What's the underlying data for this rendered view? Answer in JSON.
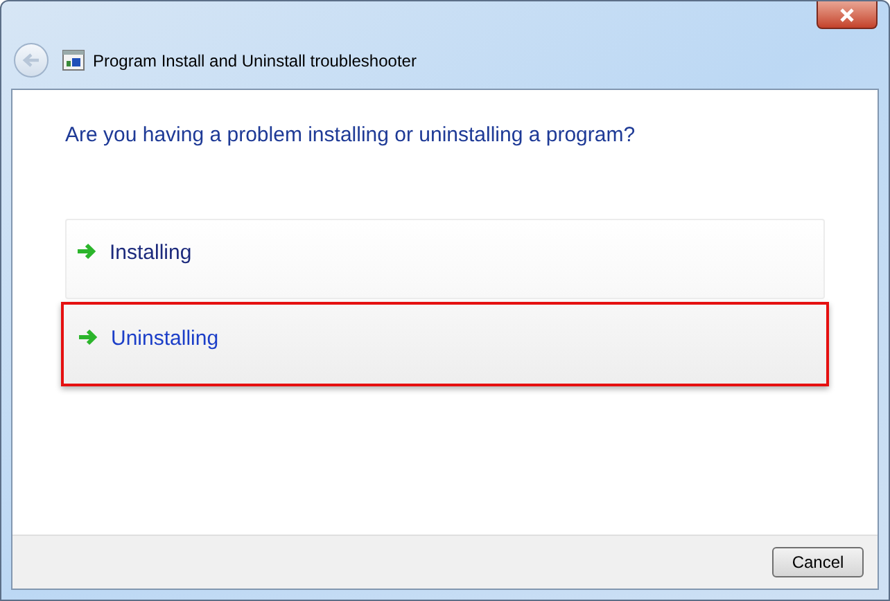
{
  "window": {
    "title": "Program Install and Uninstall troubleshooter"
  },
  "heading": "Are you having a problem installing or uninstalling a program?",
  "options": [
    {
      "label": "Installing",
      "selected": false
    },
    {
      "label": "Uninstalling",
      "selected": true
    }
  ],
  "buttons": [
    "Cancel"
  ]
}
